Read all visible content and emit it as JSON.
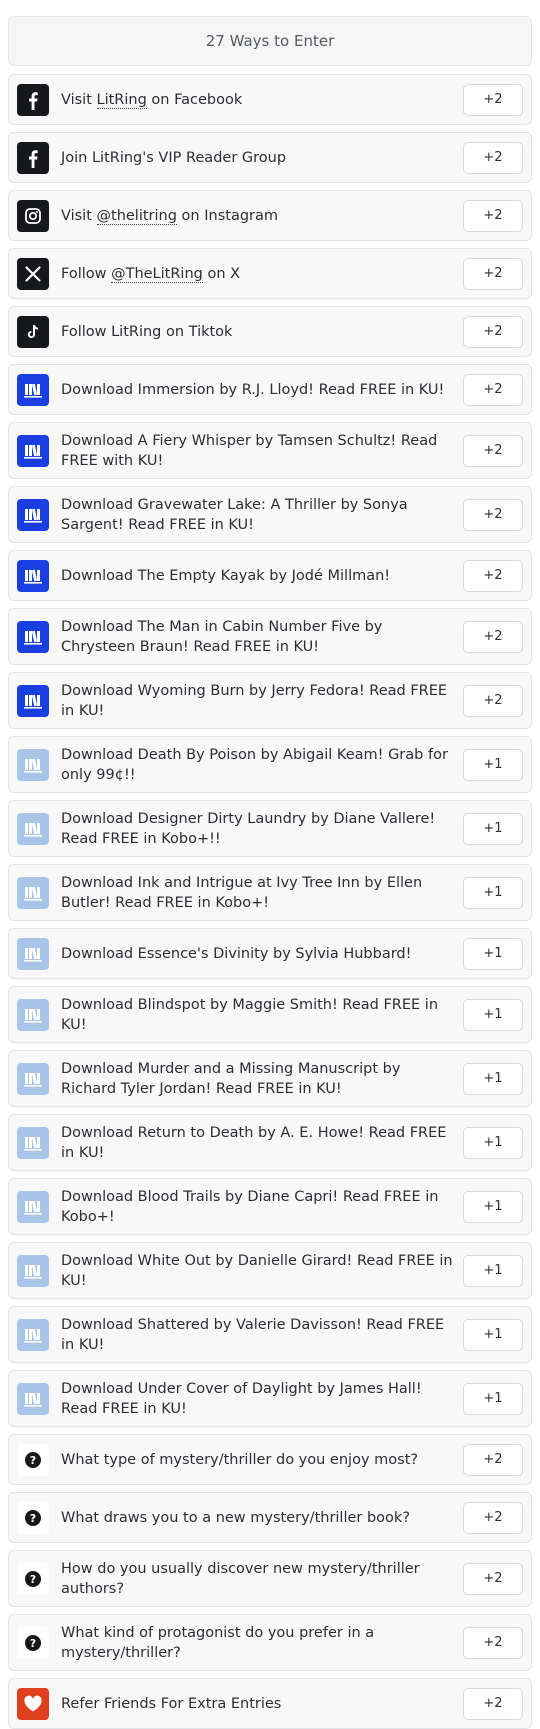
{
  "header": {
    "title": "27 Ways to Enter"
  },
  "colors": {
    "dark": "#16181b",
    "blue": "#1a3fe0",
    "light_blue": "#a8c4e6",
    "red": "#e0401e"
  },
  "entries": [
    {
      "icon": "facebook-icon",
      "style": "dark",
      "parts": [
        "Visit ",
        "LitRing",
        " on Facebook"
      ],
      "points": "+2"
    },
    {
      "icon": "facebook-icon",
      "style": "dark",
      "parts": [
        "Join LitRing's VIP Reader Group"
      ],
      "points": "+2"
    },
    {
      "icon": "instagram-icon",
      "style": "dark",
      "parts": [
        "Visit ",
        "@thelitring",
        " on Instagram"
      ],
      "points": "+2"
    },
    {
      "icon": "x-icon",
      "style": "dark",
      "parts": [
        "Follow ",
        "@TheLitRing",
        " on X"
      ],
      "points": "+2"
    },
    {
      "icon": "tiktok-icon",
      "style": "dark",
      "parts": [
        "Follow LitRing on Tiktok"
      ],
      "points": "+2"
    },
    {
      "icon": "book-download-icon",
      "style": "blue",
      "parts": [
        "Download Immersion by R.J. Lloyd! Read FREE in KU!"
      ],
      "points": "+2"
    },
    {
      "icon": "book-download-icon",
      "style": "blue",
      "parts": [
        "Download A Fiery Whisper by Tamsen Schultz! Read FREE with KU!"
      ],
      "points": "+2"
    },
    {
      "icon": "book-download-icon",
      "style": "blue",
      "parts": [
        "Download Gravewater Lake: A Thriller by Sonya Sargent! Read FREE in KU!"
      ],
      "points": "+2"
    },
    {
      "icon": "book-download-icon",
      "style": "blue",
      "parts": [
        "Download The Empty Kayak by Jodé Millman!"
      ],
      "points": "+2"
    },
    {
      "icon": "book-download-icon",
      "style": "blue",
      "parts": [
        "Download The Man in Cabin Number Five by Chrysteen Braun! Read FREE in KU!"
      ],
      "points": "+2"
    },
    {
      "icon": "book-download-icon",
      "style": "blue",
      "parts": [
        "Download Wyoming Burn by Jerry Fedora! Read FREE in KU!"
      ],
      "points": "+2"
    },
    {
      "icon": "book-download-icon",
      "style": "lblue",
      "parts": [
        "Download Death By Poison by Abigail Keam! Grab for only 99¢!!"
      ],
      "points": "+1"
    },
    {
      "icon": "book-download-icon",
      "style": "lblue",
      "parts": [
        "Download Designer Dirty Laundry by Diane Vallere! Read FREE in Kobo+!!"
      ],
      "points": "+1"
    },
    {
      "icon": "book-download-icon",
      "style": "lblue",
      "parts": [
        "Download Ink and Intrigue at Ivy Tree Inn by Ellen Butler! Read FREE in Kobo+!"
      ],
      "points": "+1"
    },
    {
      "icon": "book-download-icon",
      "style": "lblue",
      "parts": [
        "Download Essence's Divinity by Sylvia Hubbard!"
      ],
      "points": "+1"
    },
    {
      "icon": "book-download-icon",
      "style": "lblue",
      "parts": [
        "Download Blindspot by Maggie Smith! Read FREE in KU!"
      ],
      "points": "+1"
    },
    {
      "icon": "book-download-icon",
      "style": "lblue",
      "parts": [
        "Download Murder and a Missing Manuscript by Richard Tyler Jordan! Read FREE in KU!"
      ],
      "points": "+1"
    },
    {
      "icon": "book-download-icon",
      "style": "lblue",
      "parts": [
        "Download Return to Death by A. E. Howe! Read FREE in KU!"
      ],
      "points": "+1"
    },
    {
      "icon": "book-download-icon",
      "style": "lblue",
      "parts": [
        "Download Blood Trails by Diane Capri! Read FREE in Kobo+!"
      ],
      "points": "+1"
    },
    {
      "icon": "book-download-icon",
      "style": "lblue",
      "parts": [
        "Download White Out by Danielle Girard! Read FREE in KU!"
      ],
      "points": "+1"
    },
    {
      "icon": "book-download-icon",
      "style": "lblue",
      "parts": [
        "Download Shattered by Valerie Davisson! Read FREE in KU!"
      ],
      "points": "+1"
    },
    {
      "icon": "book-download-icon",
      "style": "lblue",
      "parts": [
        "Download Under Cover of Daylight by James Hall! Read FREE in KU!"
      ],
      "points": "+1"
    },
    {
      "icon": "question-icon",
      "style": "plain",
      "parts": [
        "What type of mystery/thriller do you enjoy most?"
      ],
      "points": "+2"
    },
    {
      "icon": "question-icon",
      "style": "plain",
      "parts": [
        "What draws you to a new mystery/thriller book?"
      ],
      "points": "+2"
    },
    {
      "icon": "question-icon",
      "style": "plain",
      "parts": [
        "How do you usually discover new mystery/thriller authors?"
      ],
      "points": "+2"
    },
    {
      "icon": "question-icon",
      "style": "plain",
      "parts": [
        "What kind of protagonist do you prefer in a mystery/thriller?"
      ],
      "points": "+2"
    },
    {
      "icon": "heart-icon",
      "style": "red",
      "parts": [
        "Refer Friends For Extra Entries"
      ],
      "points": "+2"
    }
  ]
}
